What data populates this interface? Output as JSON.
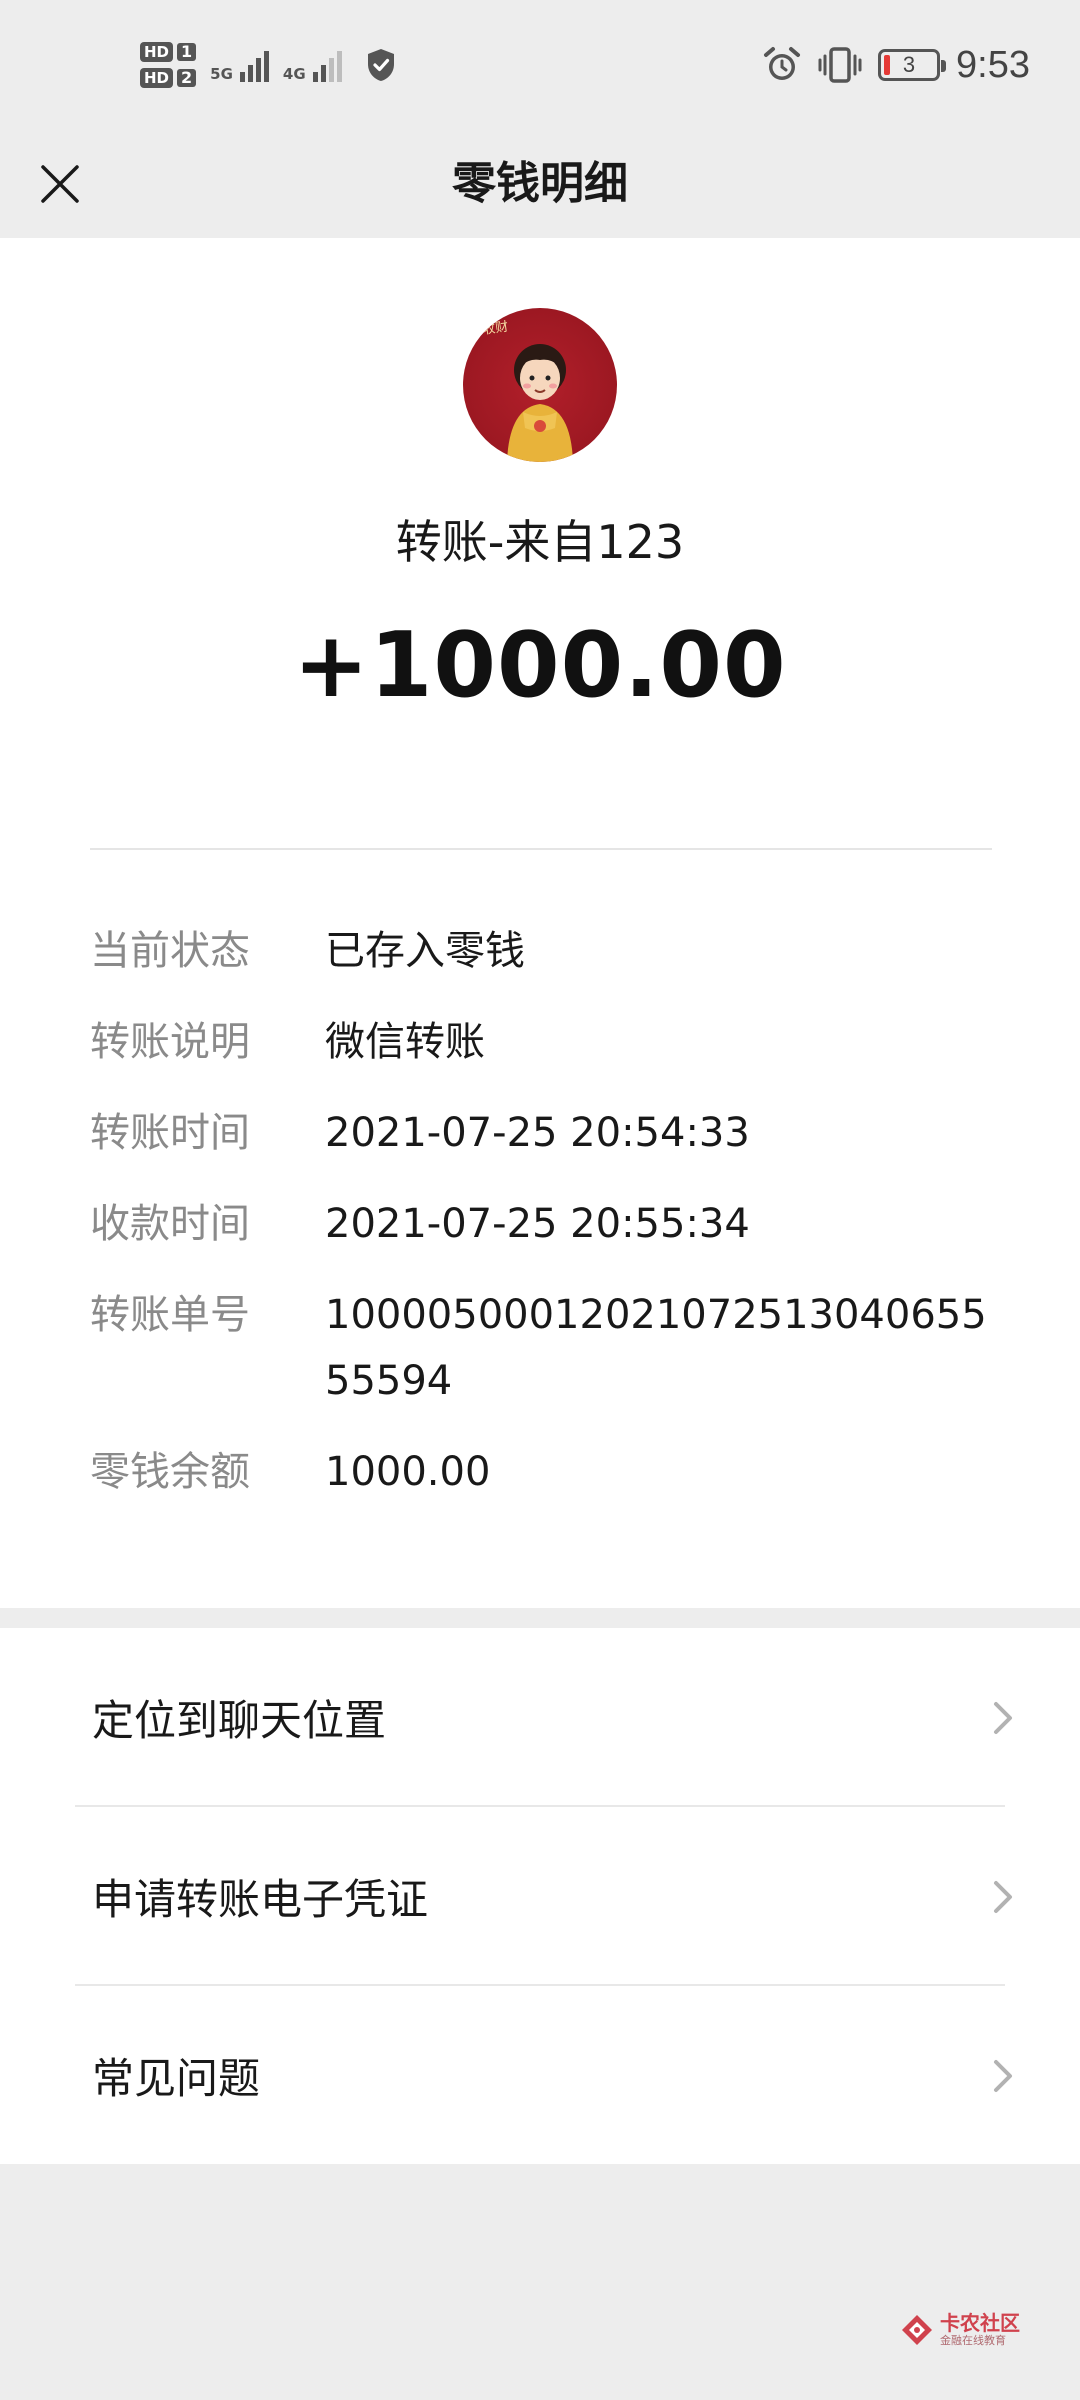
{
  "status_bar": {
    "sim1_label": "HD",
    "sim1_num": "1",
    "sim2_label": "HD",
    "sim2_num": "2",
    "net1": "5G",
    "net2": "4G",
    "battery_level": "3",
    "time": "9:53"
  },
  "header": {
    "title": "零钱明细"
  },
  "transaction": {
    "title": "转账-来自123",
    "amount": "+1000.00",
    "details": [
      {
        "label": "当前状态",
        "value": "已存入零钱"
      },
      {
        "label": "转账说明",
        "value": "微信转账"
      },
      {
        "label": "转账时间",
        "value": "2021-07-25 20:54:33"
      },
      {
        "label": "收款时间",
        "value": "2021-07-25 20:55:34"
      },
      {
        "label": "转账单号",
        "value": "1000050001202107251304065555594"
      },
      {
        "label": "零钱余额",
        "value": "1000.00"
      }
    ]
  },
  "menu": {
    "items": [
      {
        "label": "定位到聊天位置"
      },
      {
        "label": "申请转账电子凭证"
      },
      {
        "label": "常见问题"
      }
    ]
  },
  "watermark": {
    "main": "卡农社区",
    "sub": "金融在线教育"
  },
  "colors": {
    "page_bg": "#ededed",
    "card_bg": "#ffffff",
    "label_gray": "#8a8a8a",
    "text": "#191919",
    "avatar_red": "#a31b25"
  }
}
